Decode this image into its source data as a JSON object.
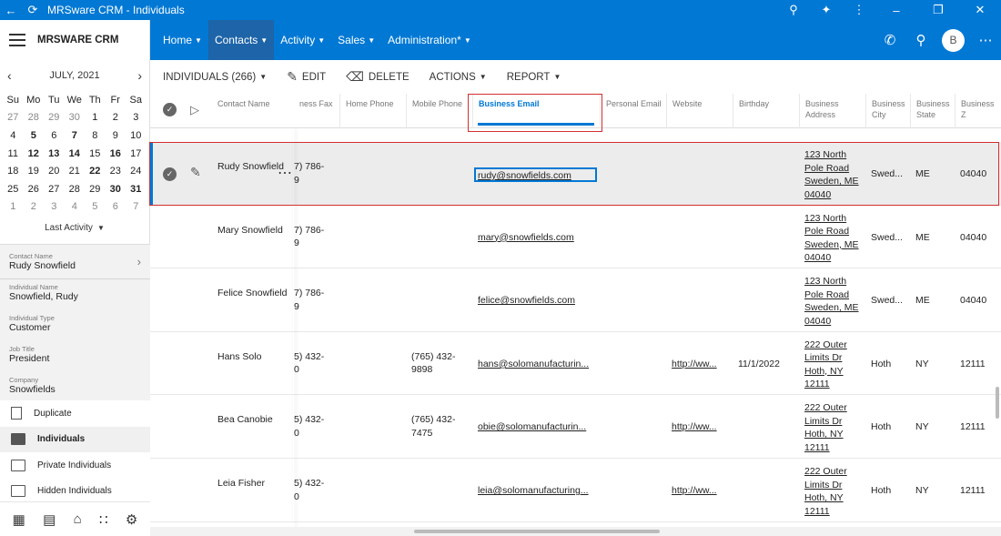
{
  "titlebar": {
    "title": "MRSware CRM - Individuals"
  },
  "app": {
    "name": "MRSWARE CRM"
  },
  "calendar": {
    "month_label": "JULY, 2021",
    "weekdays": [
      "Su",
      "Mo",
      "Tu",
      "We",
      "Th",
      "Fr",
      "Sa"
    ],
    "weeks": [
      [
        "27",
        "28",
        "29",
        "30",
        "1",
        "2",
        "3"
      ],
      [
        "4",
        "5",
        "6",
        "7",
        "8",
        "9",
        "10"
      ],
      [
        "11",
        "12",
        "13",
        "14",
        "15",
        "16",
        "17"
      ],
      [
        "18",
        "19",
        "20",
        "21",
        "22",
        "23",
        "24"
      ],
      [
        "25",
        "26",
        "27",
        "28",
        "29",
        "30",
        "31"
      ],
      [
        "1",
        "2",
        "3",
        "4",
        "5",
        "6",
        "7"
      ]
    ],
    "last_activity_label": "Last Activity"
  },
  "details": {
    "contact_name_label": "Contact Name",
    "contact_name": "Rudy Snowfield",
    "individual_name_label": "Individual Name",
    "individual_name": "Snowfield, Rudy",
    "individual_type_label": "Individual Type",
    "individual_type": "Customer",
    "job_title_label": "Job Title",
    "job_title": "President",
    "company_label": "Company",
    "company": "Snowfields"
  },
  "nav_list": [
    {
      "label": "Duplicate"
    },
    {
      "label": "Individuals"
    },
    {
      "label": "Private Individuals"
    },
    {
      "label": "Hidden Individuals"
    }
  ],
  "menu": [
    {
      "label": "Home"
    },
    {
      "label": "Contacts"
    },
    {
      "label": "Activity"
    },
    {
      "label": "Sales"
    },
    {
      "label": "Administration*"
    }
  ],
  "avatar_initial": "B",
  "toolbar": {
    "view_label": "INDIVIDUALS (266)",
    "edit_label": "EDIT",
    "delete_label": "DELETE",
    "actions_label": "ACTIONS",
    "report_label": "REPORT"
  },
  "columns": {
    "contact_name": "Contact Name",
    "business_fax": "ness Fax",
    "home_phone": "Home Phone",
    "mobile_phone": "Mobile Phone",
    "business_email": "Business Email",
    "personal_email": "Personal Email",
    "website": "Website",
    "birthday": "Birthday",
    "business_address": "Business Address",
    "business_city": "Business City",
    "business_state": "Business State",
    "business_zip": "Business Z"
  },
  "rows": [
    {
      "name": "Rudy Snowfield",
      "fax": "7) 786-\n9",
      "mobile": "",
      "email": "rudy@snowfields.com",
      "website": "",
      "birthday": "",
      "address": "123 North\nPole Road\nSweden, ME\n04040",
      "city": "Swed...",
      "state": "ME",
      "zip": "04040"
    },
    {
      "name": "Mary Snowfield",
      "fax": "7) 786-\n9",
      "mobile": "",
      "email": "mary@snowfields.com",
      "website": "",
      "birthday": "",
      "address": "123 North\nPole Road\nSweden, ME\n04040",
      "city": "Swed...",
      "state": "ME",
      "zip": "04040"
    },
    {
      "name": "Felice Snowfield",
      "fax": "7) 786-\n9",
      "mobile": "",
      "email": "felice@snowfields.com",
      "website": "",
      "birthday": "",
      "address": "123 North\nPole Road\nSweden, ME\n04040",
      "city": "Swed...",
      "state": "ME",
      "zip": "04040"
    },
    {
      "name": "Hans Solo",
      "fax": "5) 432-\n0",
      "mobile": "(765) 432-\n9898",
      "email": "hans@solomanufacturin...",
      "website": "http://ww...",
      "birthday": "11/1/2022",
      "address": "222 Outer\nLimits Dr\nHoth, NY\n12111",
      "city": "Hoth",
      "state": "NY",
      "zip": "12111"
    },
    {
      "name": "Bea Canobie",
      "fax": "5) 432-\n0",
      "mobile": "(765) 432-\n7475",
      "email": "obie@solomanufacturin...",
      "website": "http://ww...",
      "birthday": "",
      "address": "222 Outer\nLimits Dr\nHoth, NY\n12111",
      "city": "Hoth",
      "state": "NY",
      "zip": "12111"
    },
    {
      "name": "Leia Fisher",
      "fax": "5) 432-\n0",
      "mobile": "",
      "email": "leia@solomanufacturing...",
      "website": "http://ww...",
      "birthday": "",
      "address": "222 Outer\nLimits Dr\nHoth, NY\n12111",
      "city": "Hoth",
      "state": "NY",
      "zip": "12111"
    }
  ]
}
